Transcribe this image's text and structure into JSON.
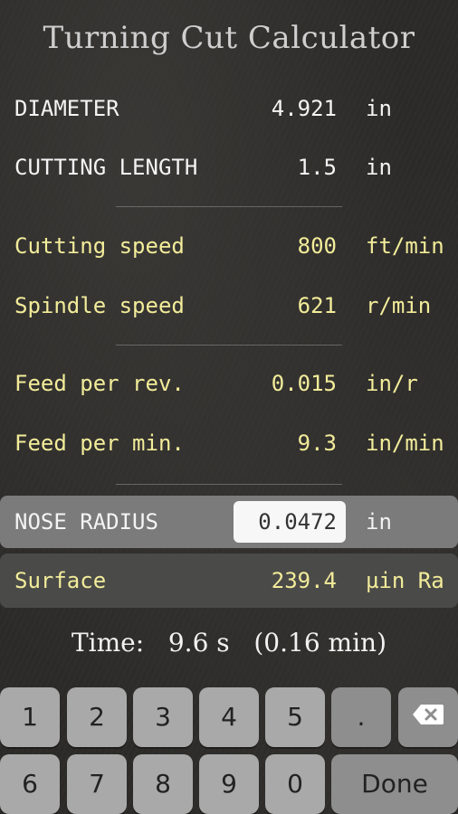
{
  "title": "Turning Cut Calculator",
  "rows": {
    "diameter": {
      "label": "DIAMETER",
      "value": "4.921",
      "unit": "in"
    },
    "cutting_length": {
      "label": "CUTTING LENGTH",
      "value": "1.5",
      "unit": "in"
    },
    "cutting_speed": {
      "label": "Cutting speed",
      "value": "800",
      "unit": "ft/min"
    },
    "spindle_speed": {
      "label": "Spindle speed",
      "value": "621",
      "unit": "r/min"
    },
    "feed_per_rev": {
      "label": "Feed per rev.",
      "value": "0.015",
      "unit": "in/r"
    },
    "feed_per_min": {
      "label": "Feed per min.",
      "value": "9.3",
      "unit": "in/min"
    },
    "nose_radius": {
      "label": "NOSE RADIUS",
      "value": "0.0472",
      "unit": "in"
    },
    "surface": {
      "label": "Surface",
      "value": "239.4",
      "unit": "µin Ra"
    }
  },
  "time": {
    "label": "Time:",
    "seconds": "9.6 s",
    "minutes": "(0.16 min)"
  },
  "keypad": {
    "keys": [
      "1",
      "2",
      "3",
      "4",
      "5",
      ".",
      "6",
      "7",
      "8",
      "9",
      "0"
    ],
    "done_label": "Done",
    "delete_icon": "backspace-icon"
  },
  "colors": {
    "input_labels": "#f4f4f4",
    "output_labels": "#f2ec9a",
    "background": "#2b2a28"
  }
}
